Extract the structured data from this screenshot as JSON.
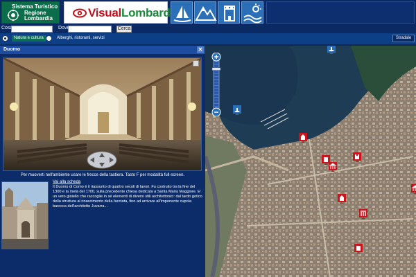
{
  "header": {
    "region_line1": "Sistema Turistico",
    "region_line2": "Regione",
    "region_line3": "Lombardia",
    "logo_part1": "Visual",
    "logo_part2": "Lombardia",
    "nav_icons": [
      "sailboat-icon",
      "mountain-icon",
      "castle-icon",
      "sun-sea-icon"
    ]
  },
  "search": {
    "what_label": "Cosa",
    "what_value": "",
    "where_label": "Dove",
    "where_value": "",
    "button_label": "Cerca"
  },
  "filters": {
    "options": [
      {
        "label": "Natura e cultura",
        "selected": true
      },
      {
        "label": "Alberghi, ristoranti, servizi",
        "selected": false
      }
    ],
    "map_type_label": "Stradale"
  },
  "panel": {
    "title": "Duomo",
    "close_label": "✕",
    "pano_hint": "Per muoverti nell'ambiente usare le frecce della tastiera. Tasto F per modalità full-screen.",
    "link_label": "Vai alla scheda",
    "description": "Il Duomo di Como è il riassunto di quattro secoli di lavori. Fu costruito tra la fine del 1300 e la metà del 1700, sulla precedente chiesa dedicata a Santa Maria Maggiore. E' un vero gioiello che raccoglie in sé elementi di diversi stili architettonici: dal tardo gotico della struttura al rinascimento della facciata, fino ad arrivare all'imponente cupola barocca dell'architetto Juvarra..."
  },
  "map": {
    "zoom_level": 0.15,
    "poi_icons": [
      "church-icon",
      "museum-icon",
      "castle-icon",
      "monument-icon",
      "palace-icon"
    ]
  },
  "colors": {
    "navy": "#0b2a63",
    "panel": "#0b2c68",
    "accent_green": "#0a6f55",
    "logo_red": "#c0101a",
    "logo_green": "#1a8a3a",
    "poi_red": "#c8161e"
  }
}
